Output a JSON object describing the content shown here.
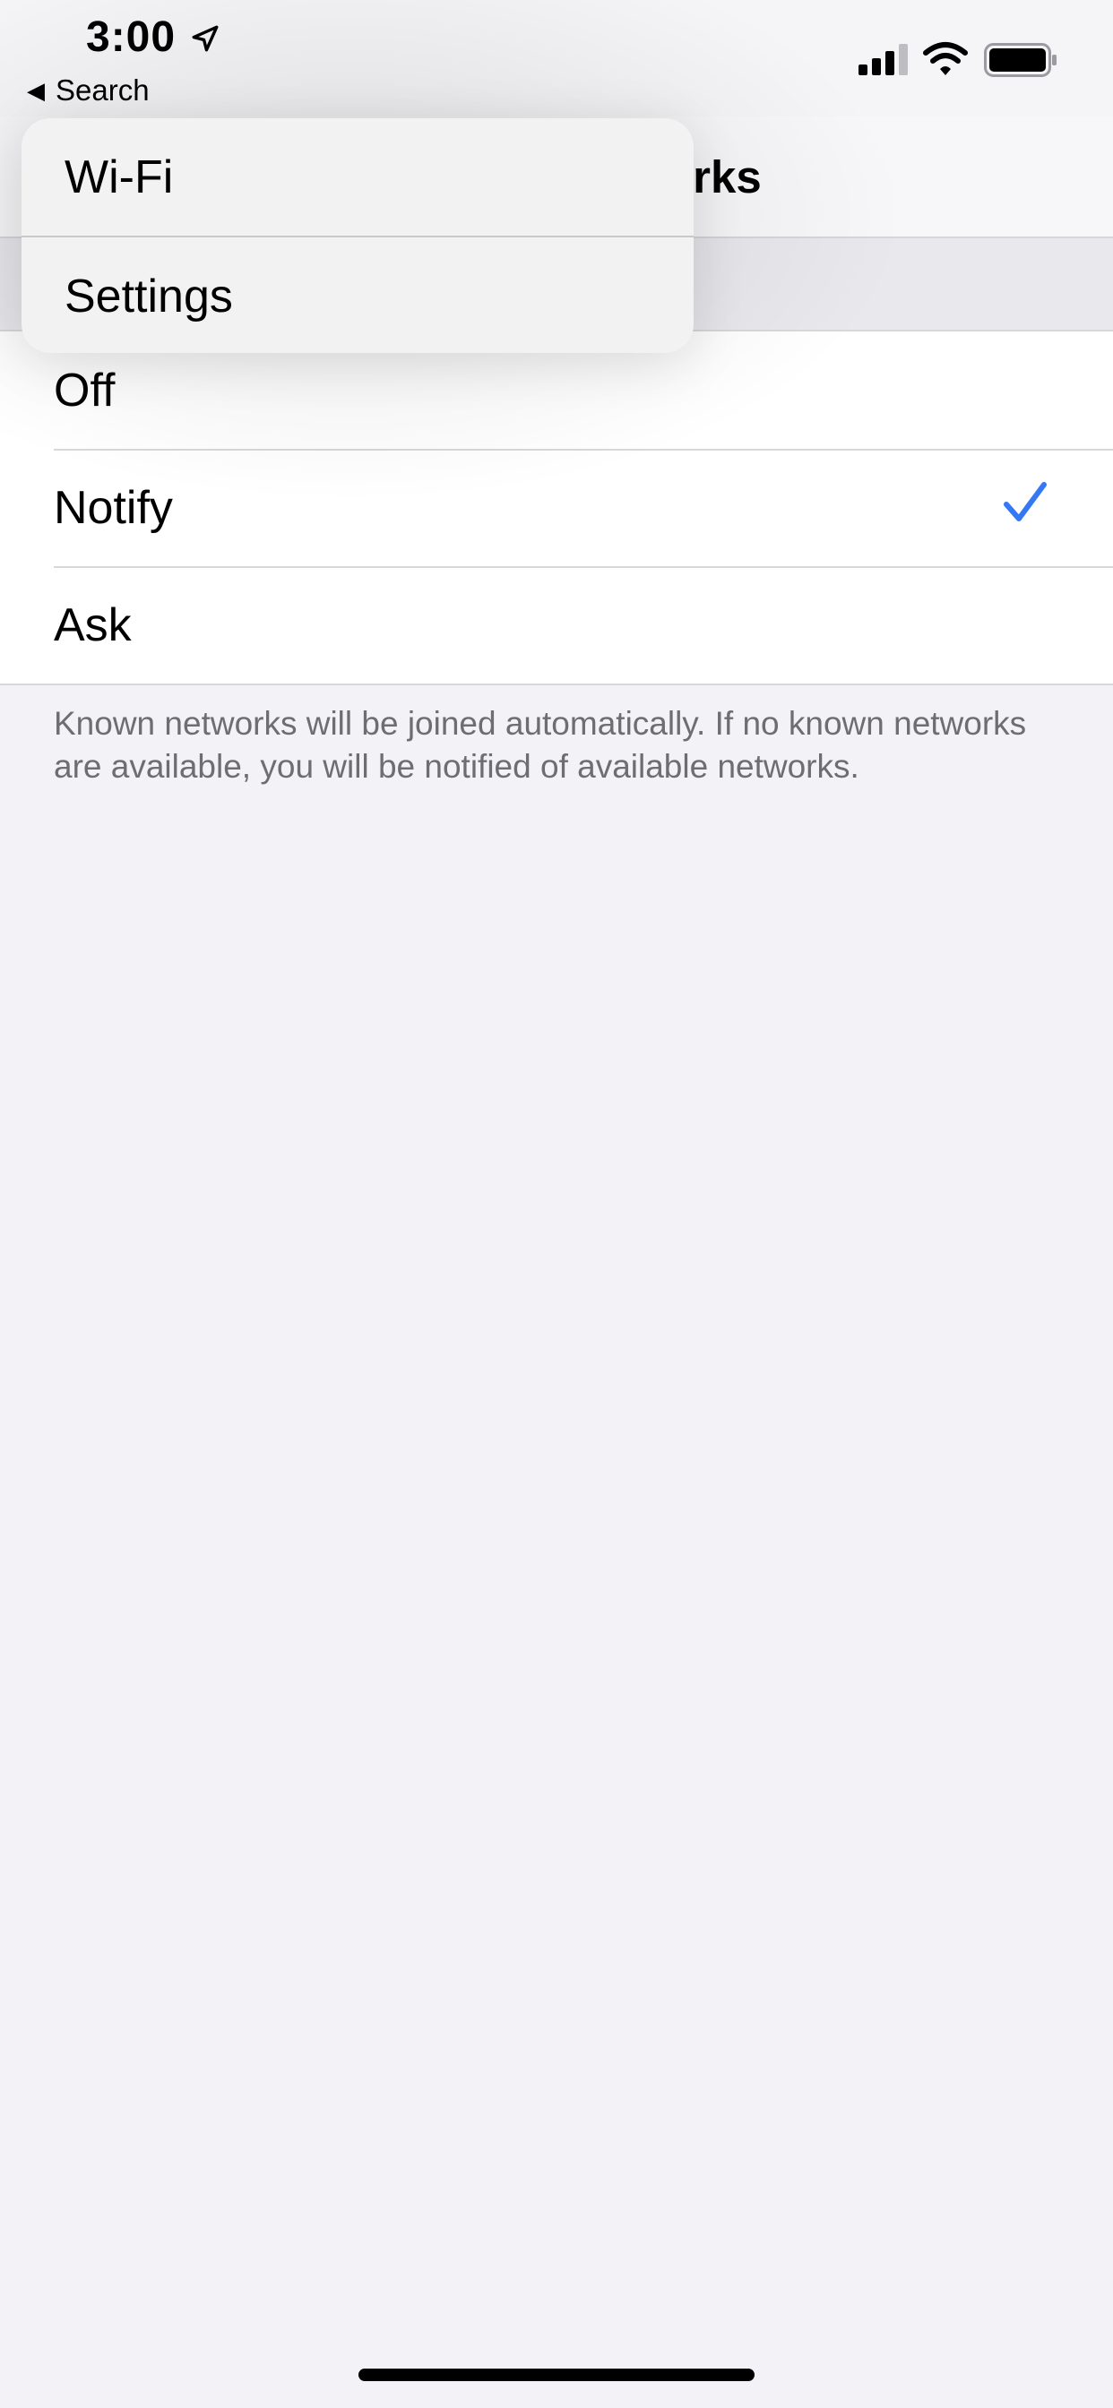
{
  "status_bar": {
    "time": "3:00",
    "back_label": "Search",
    "icons": [
      "location-arrow-icon",
      "cellular-signal-icon",
      "wifi-icon",
      "battery-icon"
    ]
  },
  "nav": {
    "title_visible_fragment": "orks"
  },
  "options": [
    {
      "label": "Off",
      "selected": false
    },
    {
      "label": "Notify",
      "selected": true
    },
    {
      "label": "Ask",
      "selected": false
    }
  ],
  "footer": {
    "text": "Known networks will be joined automatically. If no known networks are available, you will be notified of available networks."
  },
  "menu": {
    "items": [
      {
        "label": "Wi-Fi"
      },
      {
        "label": "Settings"
      }
    ]
  },
  "colors": {
    "accent": "#3478f6",
    "background": "#f2f2f7",
    "secondary_text": "#6d6d72"
  }
}
